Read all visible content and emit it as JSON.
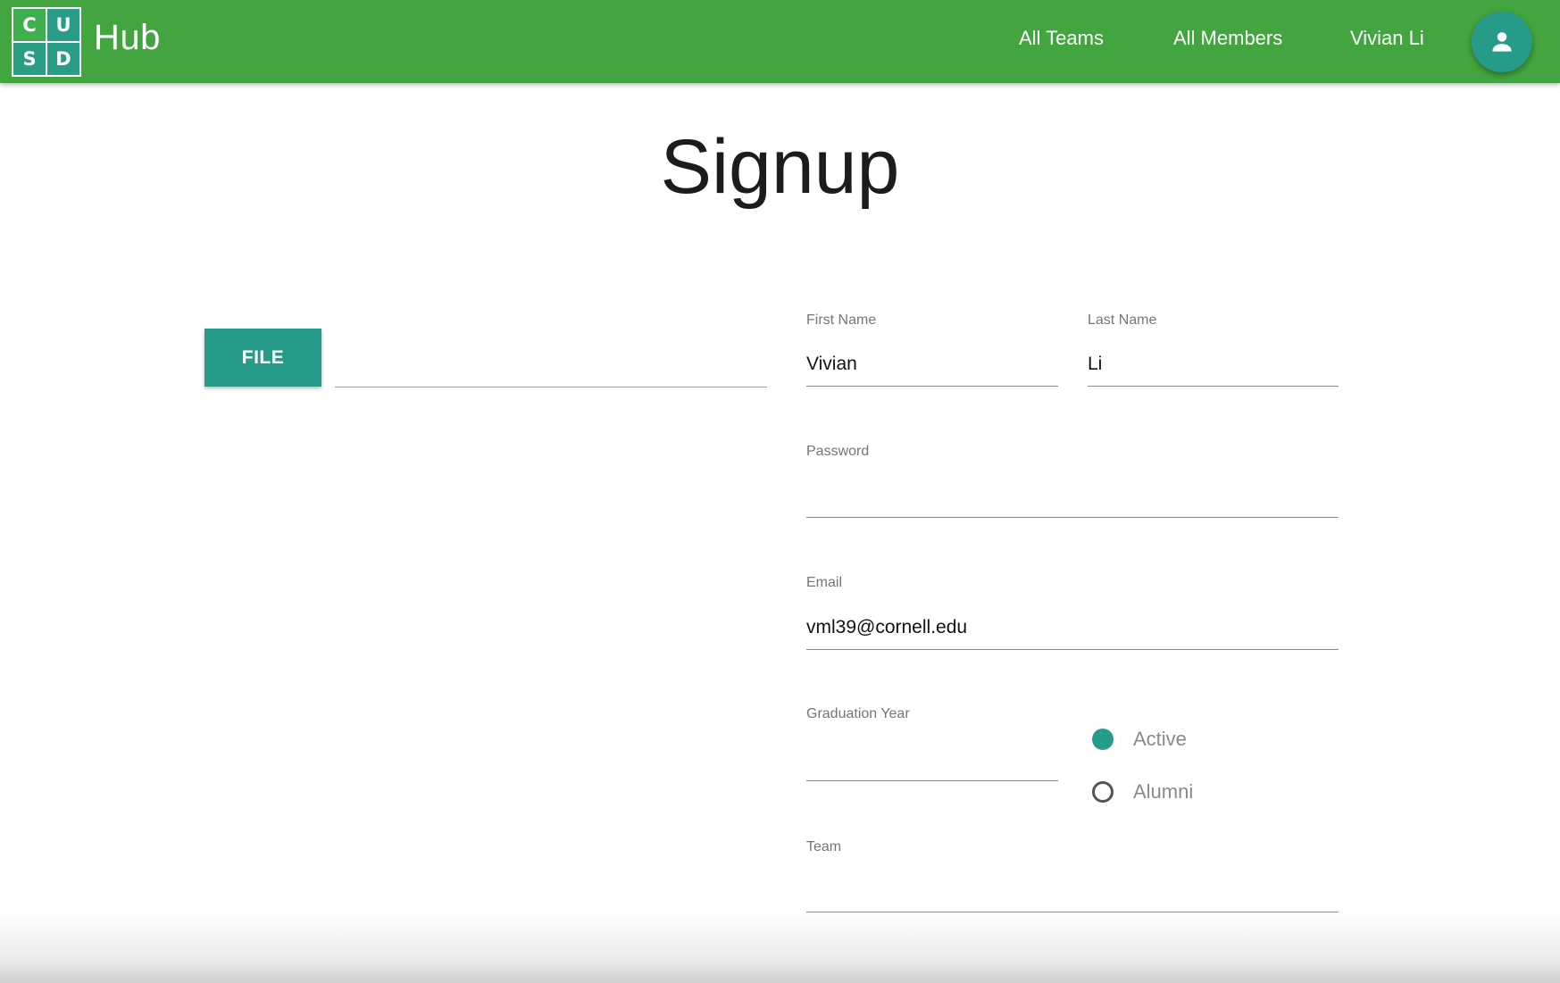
{
  "navbar": {
    "logo_letters": [
      "C",
      "U",
      "S",
      "D"
    ],
    "logo_colors": [
      "#3fae4d",
      "#2a9d86",
      "#2a9d86",
      "#2a9d86"
    ],
    "brand": "Hub",
    "links": [
      "All Teams",
      "All Members",
      "Vivian Li"
    ],
    "avatar_icon": "person-icon",
    "background_color": "#43a53f"
  },
  "page": {
    "title": "Signup"
  },
  "file_upload": {
    "button_label": "FILE",
    "path_value": ""
  },
  "form": {
    "first_name": {
      "label": "First Name",
      "value": "Vivian"
    },
    "last_name": {
      "label": "Last Name",
      "value": "Li"
    },
    "password": {
      "label": "Password",
      "value": ""
    },
    "email": {
      "label": "Email",
      "value": "vml39@cornell.edu"
    },
    "graduation_year": {
      "label": "Graduation Year",
      "value": ""
    },
    "status_options": [
      {
        "label": "Active",
        "checked": true
      },
      {
        "label": "Alumni",
        "checked": false
      }
    ],
    "team": {
      "label": "Team",
      "value": ""
    }
  },
  "colors": {
    "accent": "#269b8a",
    "navbar": "#43a53f"
  }
}
